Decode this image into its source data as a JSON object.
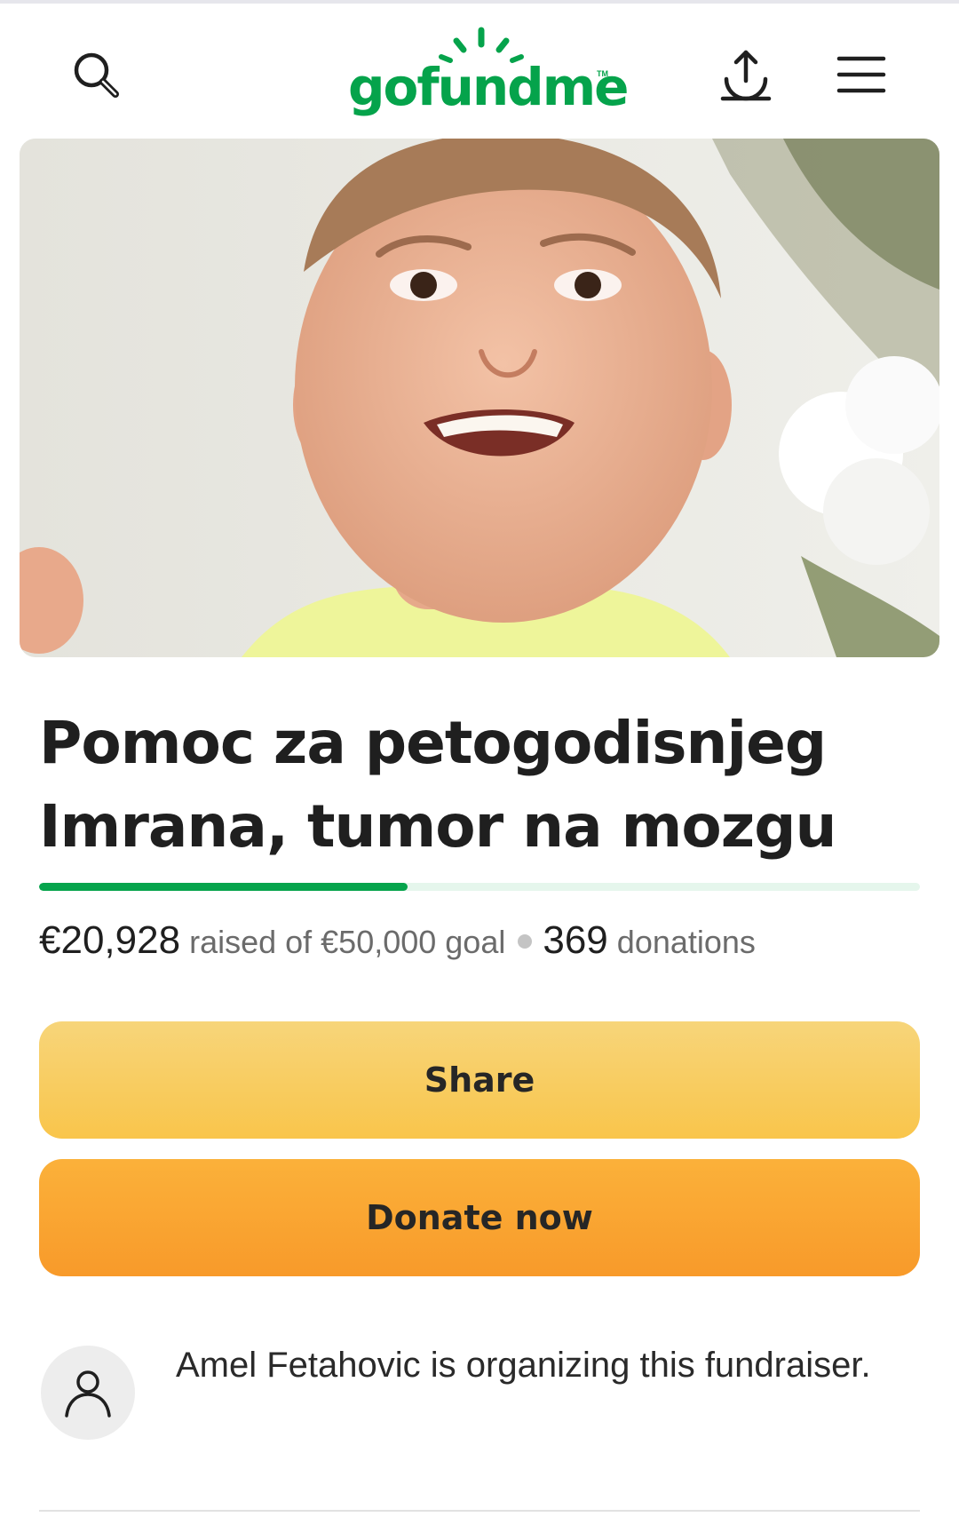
{
  "header": {
    "logo_text": "gofundme",
    "logo_tm": "TM",
    "icons": [
      "search-icon",
      "share-upload-icon",
      "hamburger-menu-icon"
    ]
  },
  "campaign": {
    "title": "Pomoc za petogodisnjeg Imrana, tumor na mozgu",
    "raised": "€20,928",
    "raised_text": "raised of €50,000 goal",
    "donations_count": "369",
    "donations_text": "donations",
    "progress_fraction": 0.4186
  },
  "actions": {
    "share_label": "Share",
    "donate_label": "Donate now"
  },
  "organizer": {
    "text": "Amel Fetahovic is organizing this fundraiser."
  },
  "colors": {
    "brand_green": "#05a34b",
    "share_yellow": "#f8cf63",
    "donate_orange": "#f9a633"
  }
}
